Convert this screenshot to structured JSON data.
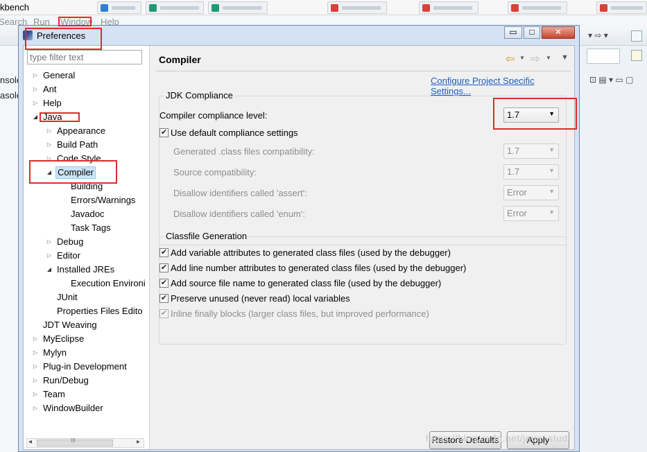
{
  "workbench": {
    "title": "kbench",
    "menus": [
      "Search",
      "Run",
      "Window",
      "Help"
    ],
    "console_tabs": [
      "nsole",
      "asole"
    ]
  },
  "dialog": {
    "title": "Preferences",
    "filter_placeholder": "type filter text",
    "window_buttons": {
      "minimize": "▭",
      "maximize": "□",
      "close": "✕"
    }
  },
  "tree": {
    "items": [
      {
        "label": "General",
        "expanded": false
      },
      {
        "label": "Ant",
        "expanded": false
      },
      {
        "label": "Help",
        "expanded": false
      },
      {
        "label": "Java",
        "expanded": true
      },
      {
        "label": "Appearance",
        "expanded": false
      },
      {
        "label": "Build Path",
        "expanded": false
      },
      {
        "label": "Code Style",
        "expanded": false
      },
      {
        "label": "Compiler",
        "expanded": true,
        "selected": true
      },
      {
        "label": "Building"
      },
      {
        "label": "Errors/Warnings"
      },
      {
        "label": "Javadoc"
      },
      {
        "label": "Task Tags"
      },
      {
        "label": "Debug",
        "expanded": false
      },
      {
        "label": "Editor",
        "expanded": false
      },
      {
        "label": "Installed JREs",
        "expanded": true
      },
      {
        "label": "Execution Environi"
      },
      {
        "label": "JUnit"
      },
      {
        "label": "Properties Files Edito"
      },
      {
        "label": "JDT Weaving"
      },
      {
        "label": "MyEclipse",
        "expanded": false
      },
      {
        "label": "Mylyn",
        "expanded": false
      },
      {
        "label": "Plug-in Development",
        "expanded": false
      },
      {
        "label": "Run/Debug",
        "expanded": false
      },
      {
        "label": "Team",
        "expanded": false
      },
      {
        "label": "WindowBuilder",
        "expanded": false
      }
    ],
    "scroll_label": "III"
  },
  "page": {
    "title": "Compiler",
    "config_link": "Configure Project Specific Settings...",
    "jdk_group": {
      "label": "JDK Compliance",
      "compliance_label": "Compiler compliance level:",
      "compliance_value": "1.7",
      "use_default_label": "Use default compliance settings",
      "use_default_checked": true,
      "generated_label": "Generated .class files compatibility:",
      "generated_value": "1.7",
      "source_label": "Source compatibility:",
      "source_value": "1.7",
      "assert_label": "Disallow identifiers called 'assert':",
      "assert_value": "Error",
      "enum_label": "Disallow identifiers called 'enum':",
      "enum_value": "Error"
    },
    "classfile_group": {
      "label": "Classfile Generation",
      "options": [
        {
          "label": "Add variable attributes to generated class files (used by the debugger)",
          "checked": true,
          "enabled": true
        },
        {
          "label": "Add line number attributes to generated class files (used by the debugger)",
          "checked": true,
          "enabled": true
        },
        {
          "label": "Add source file name to generated class file (used by the debugger)",
          "checked": true,
          "enabled": true
        },
        {
          "label": "Preserve unused (never read) local variables",
          "checked": true,
          "enabled": true
        },
        {
          "label": "Inline finally blocks (larger class files, but improved performance)",
          "checked": true,
          "enabled": false
        }
      ]
    },
    "buttons": {
      "restore_defaults": "Restore Defaults",
      "apply": "Apply"
    }
  },
  "watermark": "https://blog.csdn.net/java_stud",
  "colors": {
    "annotation": "#e02a2a",
    "link": "#1c5dbf",
    "selection": "#cce4f7"
  }
}
